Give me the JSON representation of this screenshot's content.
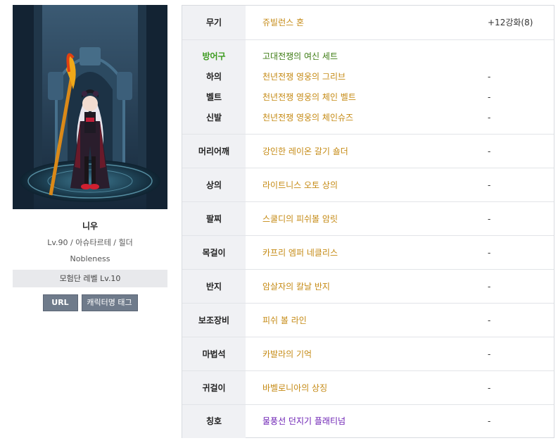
{
  "character": {
    "name": "니우",
    "info": "Lv.90 / 아슈타르테 / 힐더",
    "guild": "Nobleness",
    "adventure_level": "모험단 레벨 Lv.10",
    "url_button": "URL",
    "tag_button": "캐릭터명 태그"
  },
  "equipment": {
    "weapon": {
      "label": "무기",
      "item": "쥬빌런스 혼",
      "value": "+12강화(8)"
    },
    "armor_set": {
      "label": "방어구",
      "set_name": "고대전쟁의 여신 세트",
      "rows": [
        {
          "label": "하의",
          "item": "천년전쟁 영웅의 그리브",
          "value": "-"
        },
        {
          "label": "벨트",
          "item": "천년전쟁 영웅의 체인 벨트",
          "value": "-"
        },
        {
          "label": "신발",
          "item": "천년전쟁 영웅의 체인슈즈",
          "value": "-"
        }
      ]
    },
    "slots": [
      {
        "label": "머리어깨",
        "item": "강인한 레이온 갈기 숄더",
        "value": "-"
      },
      {
        "label": "상의",
        "item": "라이트니스 오토 상의",
        "value": "-"
      },
      {
        "label": "팔찌",
        "item": "스쿨디의 피쉬볼 암릿",
        "value": "-"
      },
      {
        "label": "목걸이",
        "item": "카프리 엠퍼 네클리스",
        "value": "-"
      },
      {
        "label": "반지",
        "item": "암살자의 칼날 반지",
        "value": "-"
      },
      {
        "label": "보조장비",
        "item": "피쉬 볼 라인",
        "value": "-"
      },
      {
        "label": "마법석",
        "item": "카발라의 기억",
        "value": "-"
      },
      {
        "label": "귀걸이",
        "item": "바벨로니아의 상징",
        "value": "-"
      },
      {
        "label": "칭호",
        "item": "물풍선 던지기 플래티넘",
        "value": "-"
      }
    ]
  },
  "colors": {
    "item_gold": "#c58a14",
    "set_green": "#3e7c14",
    "title_purple": "#6b1fb3",
    "label_bg": "#f0f1f4",
    "button_bg": "#6f7b8b"
  }
}
